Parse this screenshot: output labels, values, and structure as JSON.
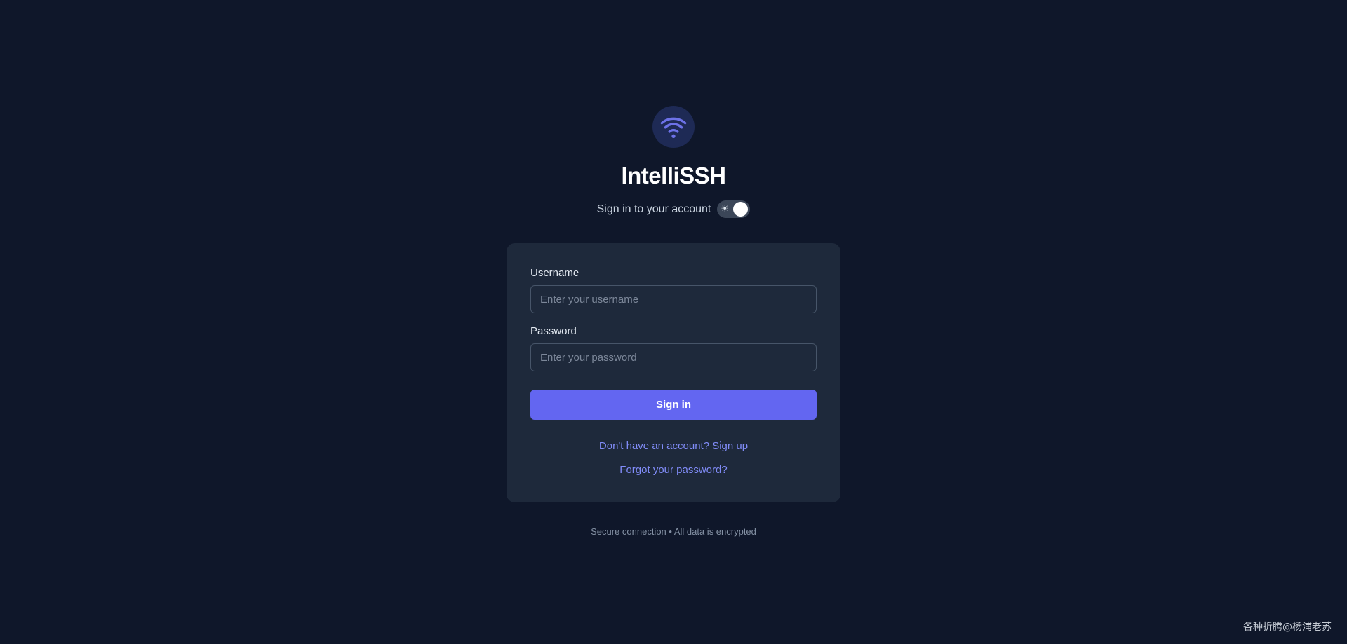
{
  "brand": {
    "icon": "wifi-icon",
    "name": "IntelliSSH",
    "subtitle": "Sign in to your account",
    "accent_color": "#6366f1"
  },
  "theme_toggle": {
    "icon": "sun-icon",
    "state": "on"
  },
  "form": {
    "username_label": "Username",
    "username_placeholder": "Enter your username",
    "username_value": "",
    "password_label": "Password",
    "password_placeholder": "Enter your password",
    "password_value": "",
    "submit_label": "Sign in"
  },
  "links": {
    "signup": "Don't have an account? Sign up",
    "forgot": "Forgot your password?"
  },
  "footer": {
    "note": "Secure connection • All data is encrypted"
  },
  "watermark": "各种折腾@杨浦老苏"
}
